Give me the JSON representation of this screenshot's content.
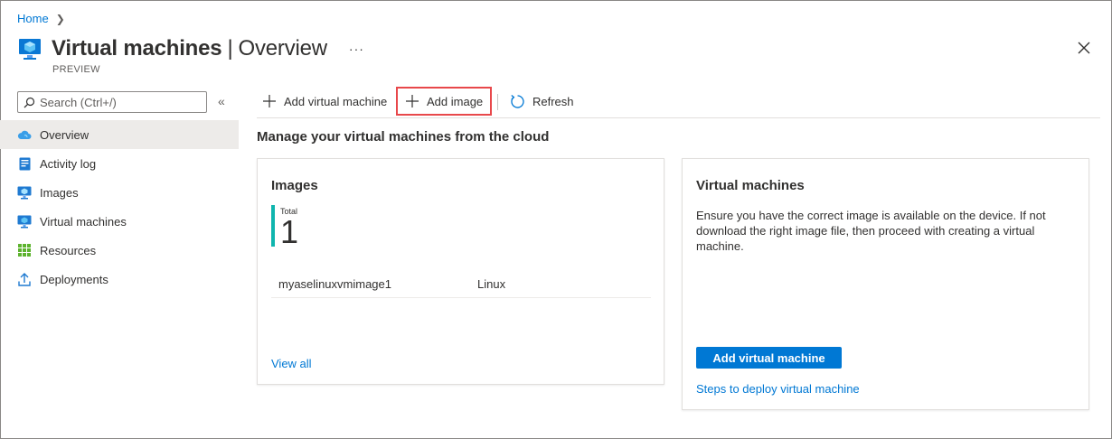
{
  "breadcrumb": {
    "home": "Home"
  },
  "header": {
    "title": "Virtual machines",
    "separator": "|",
    "subtitle": "Overview",
    "more": "···",
    "preview": "PREVIEW"
  },
  "sidebar": {
    "search_placeholder": "Search (Ctrl+/)",
    "collapse": "«",
    "items": [
      {
        "label": "Overview",
        "icon": "cloud-icon"
      },
      {
        "label": "Activity log",
        "icon": "log-icon"
      },
      {
        "label": "Images",
        "icon": "monitor-icon"
      },
      {
        "label": "Virtual machines",
        "icon": "vm-icon"
      },
      {
        "label": "Resources",
        "icon": "grid-icon"
      },
      {
        "label": "Deployments",
        "icon": "upload-icon"
      }
    ]
  },
  "toolbar": {
    "add_vm": "Add virtual machine",
    "add_image": "Add image",
    "refresh": "Refresh"
  },
  "main": {
    "heading": "Manage your virtual machines from the cloud",
    "images_card": {
      "title": "Images",
      "total_label": "Total",
      "total_value": "1",
      "rows": [
        {
          "name": "myaselinuxvmimage1",
          "os": "Linux"
        }
      ],
      "view_all": "View all"
    },
    "vms_card": {
      "title": "Virtual machines",
      "description": "Ensure you have the correct image is available on the device. If not download the right image file, then proceed with creating a virtual machine.",
      "button": "Add virtual machine",
      "link": "Steps to deploy virtual machine"
    }
  },
  "colors": {
    "accent": "#0078d4",
    "highlight": "#e8484b",
    "total_bar": "#0fb5ae"
  }
}
